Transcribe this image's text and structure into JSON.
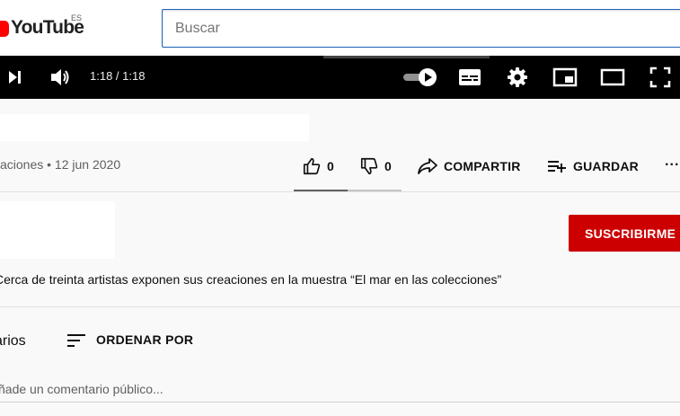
{
  "header": {
    "logo_text": "YouTube",
    "region_code": "ES",
    "search_placeholder": "Buscar"
  },
  "player": {
    "time_display": "1:18 / 1:18",
    "icons": [
      "next-icon",
      "volume-icon",
      "autoplay-toggle-icon",
      "subtitles-icon",
      "settings-icon",
      "miniplayer-icon",
      "theater-mode-icon",
      "fullscreen-icon"
    ]
  },
  "video": {
    "meta": "aciones • 12 jun 2020",
    "likes": "0",
    "dislikes": "0",
    "share_label": "COMPARTIR",
    "save_label": "GUARDAR",
    "more_label": "···"
  },
  "channel": {
    "subscribe_label": "SUSCRIBIRME",
    "description": "Cerca de treinta artistas exponen sus creaciones en la muestra “El mar en las colecciones”"
  },
  "comments": {
    "label": "arios",
    "sort_label": "ORDENAR POR",
    "input_placeholder": "ñade un comentario público..."
  },
  "colors": {
    "brand_red": "#ff0000",
    "subscribe_red": "#cc0000",
    "search_border": "#1c62b9"
  }
}
